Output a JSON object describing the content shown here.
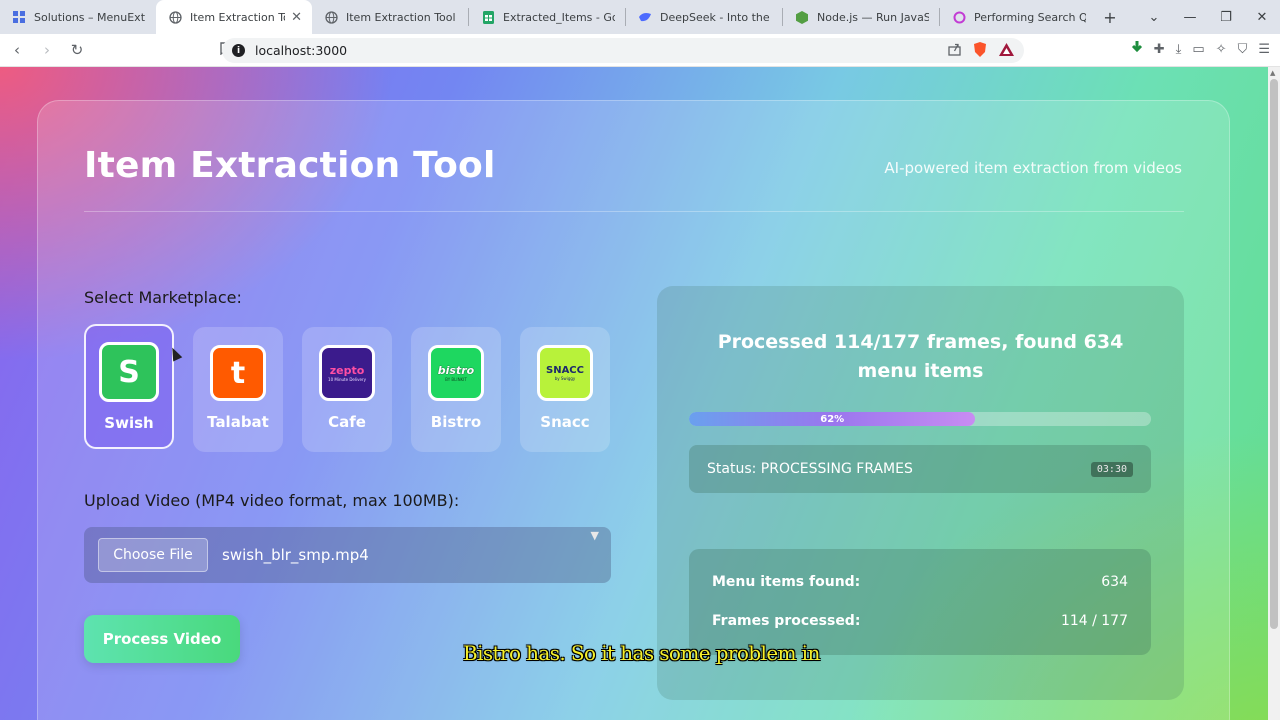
{
  "browser": {
    "tabs": [
      {
        "title": "Solutions – MenuExt – Go",
        "icon": "grid-icon",
        "active": false
      },
      {
        "title": "Item Extraction Tool",
        "icon": "globe-icon",
        "active": true
      },
      {
        "title": "Item Extraction Tool",
        "icon": "globe-icon",
        "active": false
      },
      {
        "title": "Extracted_Items - Google",
        "icon": "sheets-icon",
        "active": false
      },
      {
        "title": "DeepSeek - Into the Unkn",
        "icon": "deepseek-icon",
        "active": false
      },
      {
        "title": "Node.js — Run JavaScript",
        "icon": "nodejs-icon",
        "active": false
      },
      {
        "title": "Performing Search Querie",
        "icon": "search-app-icon",
        "active": false
      }
    ],
    "new_tab": "+",
    "url": "localhost:3000"
  },
  "page": {
    "title": "Item Extraction Tool",
    "subtitle": "AI-powered item extraction from videos",
    "marketplace_label": "Select Marketplace:",
    "marketplaces": [
      {
        "name": "Swish",
        "selected": true,
        "color": "#2ec35b"
      },
      {
        "name": "Talabat",
        "selected": false,
        "color": "#ff5a00"
      },
      {
        "name": "Cafe",
        "selected": false,
        "color": "#3b1b8c"
      },
      {
        "name": "Bistro",
        "selected": false,
        "color": "#1ed760"
      },
      {
        "name": "Snacc",
        "selected": false,
        "color": "#b8f23a"
      }
    ],
    "logo_text": {
      "swish": "S",
      "talabat": "t",
      "zepto": "zepto",
      "zepto_sub": "10 Minute Delivery",
      "bistro": "bistro",
      "bistro_sub": "BY BLINKIT",
      "snacc": "SNACC",
      "snacc_sub": "by Swiggy"
    },
    "upload_label": "Upload Video (MP4 video format, max 100MB):",
    "choose_file": "Choose File",
    "file_name": "swish_blr_smp.mp4",
    "process_button": "Process Video"
  },
  "progress_panel": {
    "heading": "Processed 114/177 frames, found 634 menu items",
    "progress_percent": 62,
    "progress_label": "62%",
    "status": "Status: PROCESSING FRAMES",
    "timer": "03:30",
    "stats": [
      {
        "label": "Menu items found:",
        "value": "634"
      },
      {
        "label": "Frames processed:",
        "value": "114 / 177"
      }
    ]
  },
  "caption": "Bistro has. So it has some problem in"
}
